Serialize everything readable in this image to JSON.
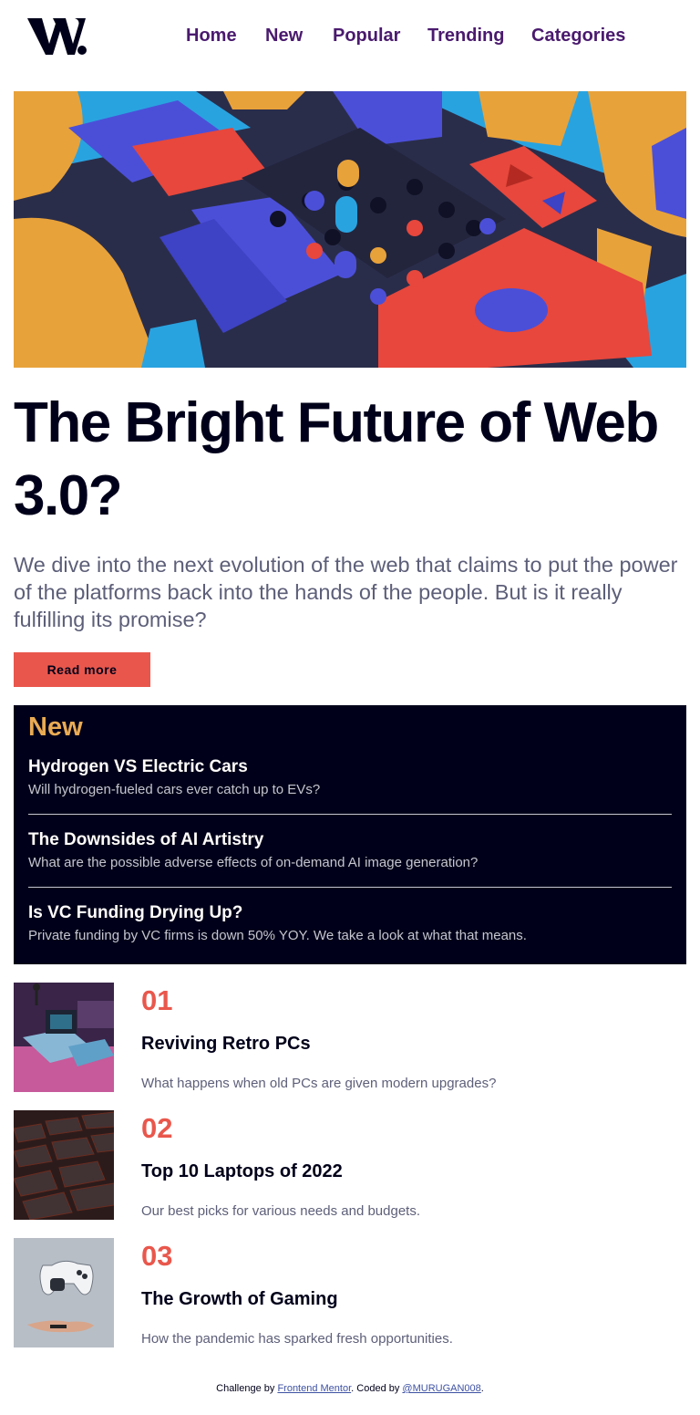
{
  "header": {
    "logo_alt": "W.",
    "nav": [
      "Home",
      "New",
      "Popular",
      "Trending",
      "Categories"
    ]
  },
  "hero": {
    "title_line1": "The Bright Future of Web",
    "title_line2": "3.0?",
    "description": "We dive into the next evolution of the web that claims to put the power of the platforms back into the hands of the people. But is it really fulfilling its promise?",
    "button": "Read more"
  },
  "new_panel": {
    "heading": "New",
    "items": [
      {
        "title": "Hydrogen VS Electric Cars",
        "desc": "Will hydrogen-fueled cars ever catch up to EVs?"
      },
      {
        "title": "The Downsides of AI Artistry",
        "desc": "What are the possible adverse effects of on-demand AI image generation?"
      },
      {
        "title": "Is VC Funding Drying Up?",
        "desc": "Private funding by VC firms is down 50% YOY. We take a look at what that means."
      }
    ]
  },
  "numbered": [
    {
      "num": "01",
      "title": "Reviving Retro PCs",
      "desc": "What happens when old PCs are given modern upgrades?"
    },
    {
      "num": "02",
      "title": "Top 10 Laptops of 2022",
      "desc": "Our best picks for various needs and budgets."
    },
    {
      "num": "03",
      "title": "The Growth of Gaming",
      "desc": "How the pandemic has sparked fresh opportunities."
    }
  ],
  "footer": {
    "prefix": "Challenge by ",
    "link1": "Frontend Mentor",
    "middle": ". Coded by ",
    "link2": "@MURUGAN008",
    "suffix": "."
  },
  "colors": {
    "accent": "#e9574c",
    "nav": "#4a1a6e",
    "new_heading": "#e9ab53",
    "dark": "#00001a"
  }
}
